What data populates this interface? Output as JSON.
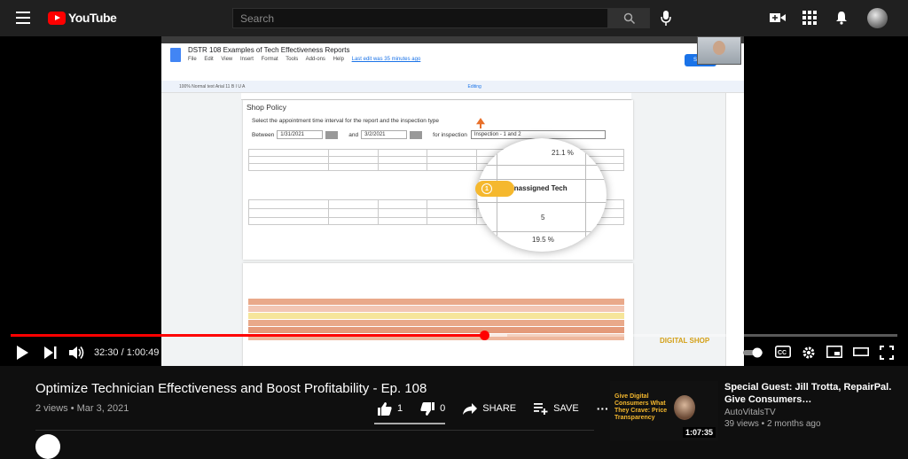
{
  "header": {
    "logo_text": "YouTube",
    "search_placeholder": "Search"
  },
  "video_content": {
    "doc_title": "DSTR 108 Examples of Tech Effectiveness Reports",
    "menu": [
      "File",
      "Edit",
      "View",
      "Insert",
      "Format",
      "Tools",
      "Add-ons",
      "Help"
    ],
    "last_edit": "Last edit was 35 minutes ago",
    "share_label": "Share",
    "toolbar_text": "100%   Normal text   Arial   11   B  I  U  A",
    "editing_label": "Editing",
    "section_title": "Shop Policy",
    "instruction": "Select the appointment time interval for the report and the inspection type",
    "between_label": "Between",
    "date_from": "1/31/2021",
    "and_label": "and",
    "date_to": "3/2/2021",
    "for_inspection_label": "for inspection",
    "inspection_value": "Inspection - 1 and 2",
    "zoom_pct_top": "21.1 %",
    "zoom_tech_label": "Unassigned Tech",
    "zoom_count": "5",
    "zoom_pct_bottom": "19.5 %",
    "badge_number": "1",
    "watermark": "DIGITAL SHOP"
  },
  "player": {
    "current_time": "32:30",
    "duration": "1:00:49",
    "time_display": "32:30 / 1:00:49",
    "progress_fraction": 0.534,
    "buffer_fraction": 0.56
  },
  "video_info": {
    "title": "Optimize Technician Effectiveness and Boost Profitability - Ep. 108",
    "meta": "2 views • Mar 3, 2021",
    "like_count": "1",
    "dislike_count": "0",
    "share_label": "SHARE",
    "save_label": "SAVE",
    "more_label": "···"
  },
  "recommendation": {
    "title": "Special Guest: Jill Trotta, RepairPal. Give Consumers…",
    "channel": "AutoVitalsTV",
    "meta": "39 views • 2 months ago",
    "duration": "1:07:35",
    "thumb_text": "Give Digital Consumers What They Crave: Price Transparency"
  },
  "colors": {
    "accent_red": "#ff0000",
    "background": "#0f0f0f",
    "header_bg": "#202020",
    "badge_yellow": "#f5b82e"
  }
}
